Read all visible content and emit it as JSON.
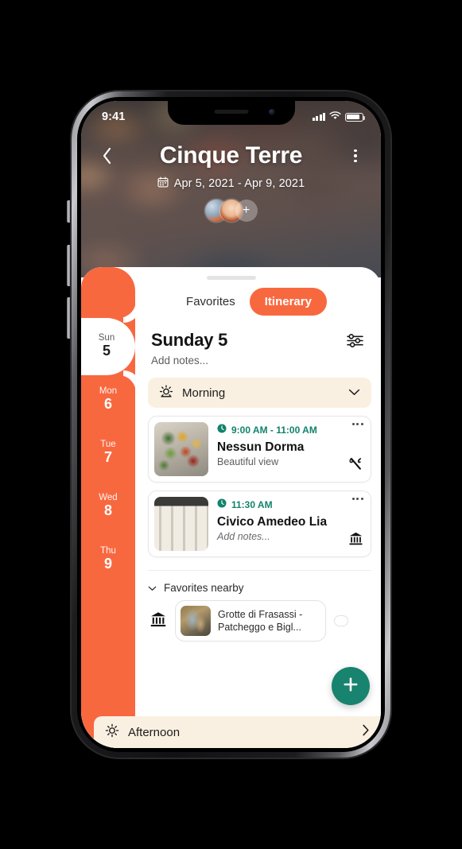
{
  "status_bar": {
    "time": "9:41",
    "signal_icon": "signal-bars-icon",
    "wifi_icon": "wifi-icon",
    "battery_icon": "battery-icon"
  },
  "hero": {
    "back_icon": "chevron-left-icon",
    "title": "Cinque Terre",
    "more_icon": "more-vertical-icon",
    "calendar_icon": "calendar-icon",
    "date_range": "Apr 5, 2021  -  Apr 9, 2021",
    "add_member_label": "+",
    "avatars": [
      "traveler-avatar-1",
      "traveler-avatar-2"
    ]
  },
  "tabs": [
    {
      "label": "Favorites",
      "active": false
    },
    {
      "label": "Itinerary",
      "active": true
    }
  ],
  "days": [
    {
      "dow": "Sun",
      "num": "5",
      "active": true
    },
    {
      "dow": "Mon",
      "num": "6",
      "active": false
    },
    {
      "dow": "Tue",
      "num": "7",
      "active": false
    },
    {
      "dow": "Wed",
      "num": "8",
      "active": false
    },
    {
      "dow": "Thu",
      "num": "9",
      "active": false
    }
  ],
  "day_header": {
    "title": "Sunday 5",
    "notes_placeholder": "Add notes...",
    "filter_icon": "filter-sliders-icon"
  },
  "morning": {
    "label": "Morning",
    "sun_icon": "sunrise-icon",
    "chevron_icon": "chevron-down-icon"
  },
  "activities": [
    {
      "time": "9:00 AM - 11:00 AM",
      "title": "Nessun Dorma",
      "subtitle": "Beautiful view",
      "subtitle_is_placeholder": false,
      "clock_icon": "clock-icon",
      "menu_icon": "more-horizontal-icon",
      "category_icon": "restaurant-icon",
      "thumb": "food-photo"
    },
    {
      "time": "11:30 AM",
      "title": "Civico Amedeo Lia",
      "subtitle": "Add notes...",
      "subtitle_is_placeholder": true,
      "clock_icon": "clock-icon",
      "menu_icon": "more-horizontal-icon",
      "category_icon": "museum-icon",
      "thumb": "museum-photo"
    }
  ],
  "favorites_nearby": {
    "label": "Favorites nearby",
    "chevron_icon": "chevron-down-icon",
    "category_icon": "museum-icon",
    "items": [
      {
        "label": "Grotte di Frasassi - Patcheggo e Bigl..."
      }
    ]
  },
  "fab": {
    "icon": "plus-icon",
    "label": "+"
  },
  "afternoon": {
    "label": "Afternoon",
    "sun_icon": "sun-icon",
    "chevron_icon": "chevron-right-icon"
  },
  "colors": {
    "orange": "#F8683F",
    "teal": "#18836E",
    "cream": "#FAF0E1",
    "time_green": "#12836C"
  }
}
